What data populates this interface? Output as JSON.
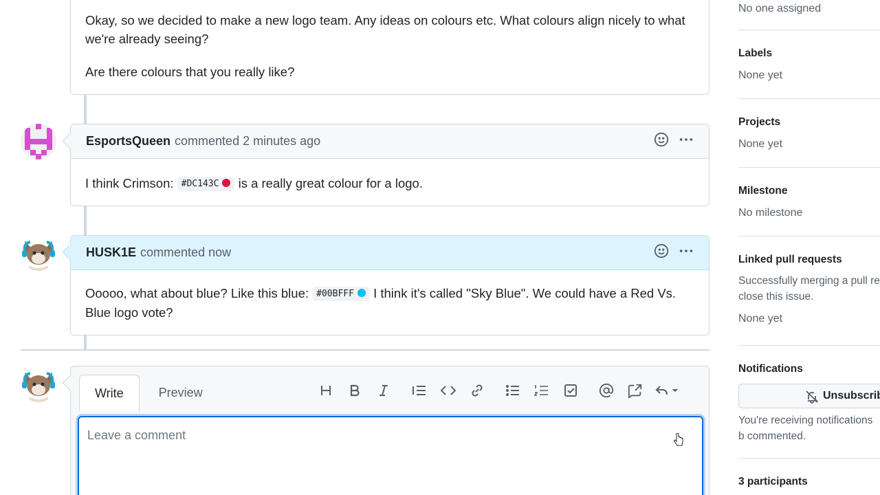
{
  "first_comment": {
    "paragraph1": "Okay, so we decided to make a new logo team. Any ideas on colours etc. What colours align nicely to what we're already seeing?",
    "paragraph2": "Are there colours that you really like?"
  },
  "comments": [
    {
      "author": "EsportsQueen",
      "action": "commented",
      "time": "2 minutes ago",
      "text_before": "I think Crimson: ",
      "code": "#DC143C",
      "swatch_color": "#DC143C",
      "text_after": " is a really great colour for a logo."
    },
    {
      "author": "HUSK1E",
      "action": "commented",
      "time": "now",
      "text_before": "Ooooo, what about blue? Like this blue: ",
      "code": "#00BFFF",
      "swatch_color": "#00BFFF",
      "text_after": " I think it's called \"Sky Blue\". We could have a Red Vs. Blue logo vote?"
    }
  ],
  "editor": {
    "tab_write": "Write",
    "tab_preview": "Preview",
    "placeholder": "Leave a comment",
    "tools": [
      "heading-icon",
      "bold-icon",
      "italic-icon",
      "quote-icon",
      "code-icon",
      "link-icon",
      "unordered-list-icon",
      "ordered-list-icon",
      "task-list-icon",
      "mention-icon",
      "cross-reference-icon",
      "reply-icon"
    ]
  },
  "sidebar": {
    "assignees_value": "No one assigned",
    "labels_title": "Labels",
    "labels_value": "None yet",
    "projects_title": "Projects",
    "projects_value": "None yet",
    "milestone_title": "Milestone",
    "milestone_value": "No milestone",
    "linked_title": "Linked pull requests",
    "linked_desc": "Successfully merging a pull re close this issue.",
    "linked_value": "None yet",
    "notifications_title": "Notifications",
    "unsubscribe_label": "Unsubscribe",
    "notifications_desc": "You're receiving notifications b commented.",
    "participants_title": "3 participants"
  }
}
